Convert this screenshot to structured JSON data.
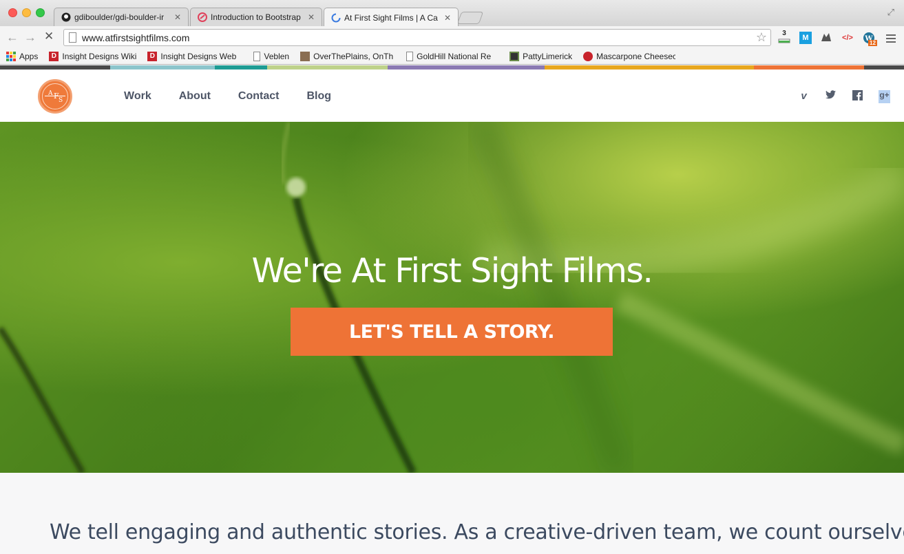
{
  "browser": {
    "tabs": [
      {
        "title": "gdiboulder/gdi-boulder-ir",
        "icon": "github-icon"
      },
      {
        "title": "Introduction to Bootstrap",
        "icon": "gdi-icon"
      },
      {
        "title": "At First Sight Films | A Ca",
        "icon": "loading-spinner-icon",
        "active": true
      }
    ],
    "url": "www.atfirstsightfilms.com",
    "extensions": {
      "badge_count": "3",
      "wp_badge": "12"
    },
    "bookmarks": [
      {
        "label": "Apps",
        "icon": "apps-grid-icon"
      },
      {
        "label": "Insight Designs Wiki",
        "icon": "insight-designs-icon"
      },
      {
        "label": "Insight Designs Web",
        "icon": "insight-designs-icon"
      },
      {
        "label": "Veblen",
        "icon": "page-icon"
      },
      {
        "label": "OverThePlains, OnTh",
        "icon": "site-icon"
      },
      {
        "label": "GoldHill National Re",
        "icon": "page-icon"
      },
      {
        "label": "PattyLimerick",
        "icon": "site-icon"
      },
      {
        "label": "Mascarpone Cheesec",
        "icon": "food-icon"
      }
    ]
  },
  "site": {
    "colors": {
      "bar": [
        "#4a4a4a",
        "#8cc5cc",
        "#1e9c94",
        "#bed28a",
        "#8b7ab3",
        "#e8a71e",
        "#ee7336",
        "#4a4a4a"
      ],
      "accent": "#ee7336",
      "nav_text": "#4d5566"
    },
    "logo": {
      "letters": [
        "A",
        "F",
        "S"
      ]
    },
    "nav": [
      "Work",
      "About",
      "Contact",
      "Blog"
    ],
    "social": [
      "vimeo-icon",
      "twitter-icon",
      "facebook-icon",
      "google-plus-icon"
    ],
    "social_glyphs": {
      "vimeo": "v",
      "twitter": "🐦",
      "facebook": "f",
      "google_plus": "g+"
    },
    "hero": {
      "title": "We're At First Sight Films.",
      "cta": "LET'S TELL A STORY."
    },
    "intro": "We tell engaging and authentic stories. As a creative-driven team, we count ourselves"
  }
}
